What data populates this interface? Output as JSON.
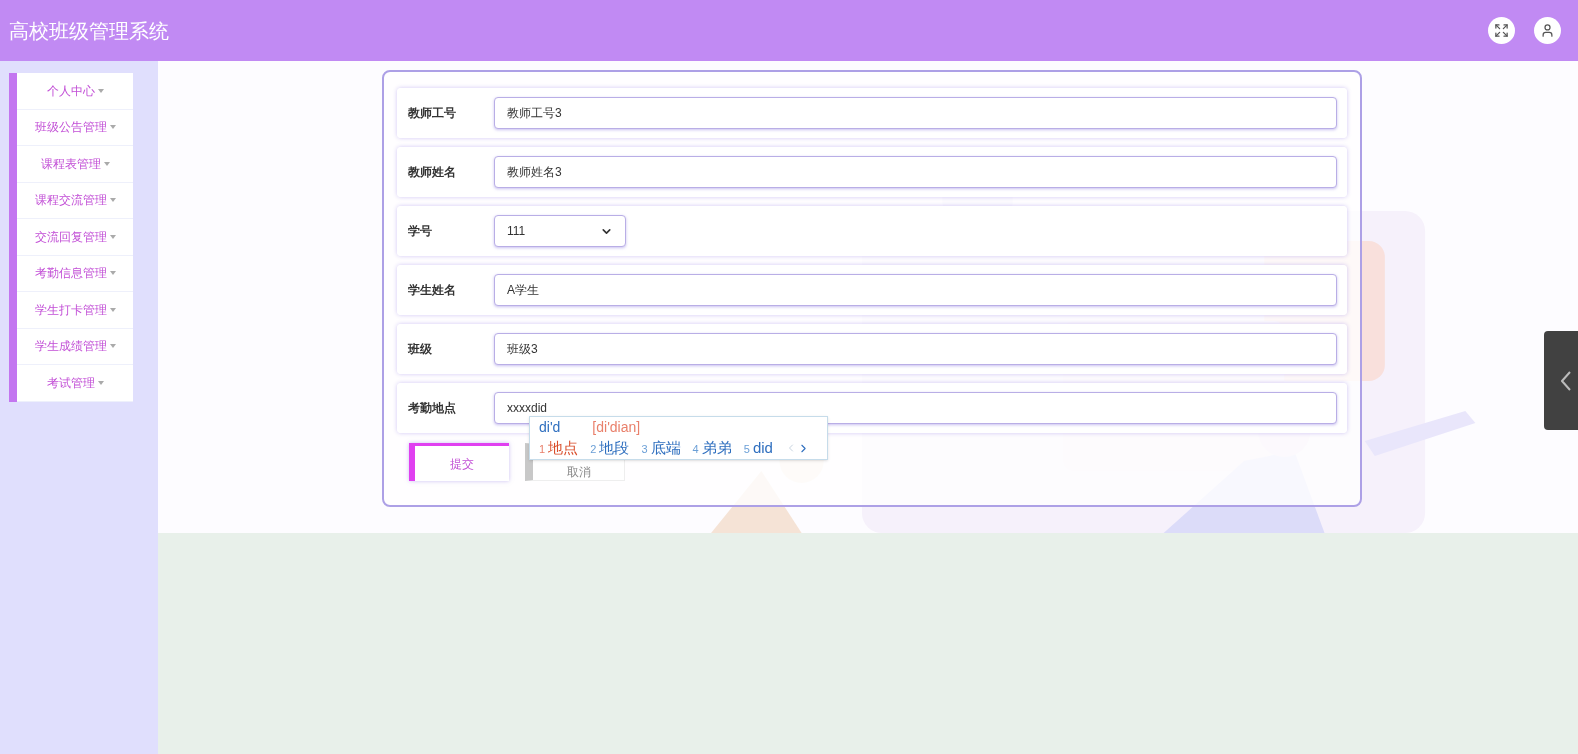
{
  "header": {
    "title": "高校班级管理系统"
  },
  "sidebar": {
    "items": [
      {
        "label": "个人中心"
      },
      {
        "label": "班级公告管理"
      },
      {
        "label": "课程表管理"
      },
      {
        "label": "课程交流管理"
      },
      {
        "label": "交流回复管理"
      },
      {
        "label": "考勤信息管理"
      },
      {
        "label": "学生打卡管理"
      },
      {
        "label": "学生成绩管理"
      },
      {
        "label": "考试管理"
      }
    ]
  },
  "form": {
    "fields": [
      {
        "kind": "text",
        "label": "教师工号",
        "value": "教师工号3"
      },
      {
        "kind": "text",
        "label": "教师姓名",
        "value": "教师姓名3"
      },
      {
        "kind": "select",
        "label": "学号",
        "value": "111"
      },
      {
        "kind": "text",
        "label": "学生姓名",
        "value": "A学生"
      },
      {
        "kind": "text",
        "label": "班级",
        "value": "班级3"
      },
      {
        "kind": "text",
        "label": "考勤地点",
        "value": "xxxxdid"
      }
    ],
    "buttons": [
      {
        "kind": "submit",
        "label": "提交"
      },
      {
        "kind": "cancel",
        "label": "取消"
      }
    ]
  },
  "ime": {
    "composition": "di'd",
    "hint": "[di'dian]",
    "candidates": [
      {
        "index": "1",
        "text": "地点",
        "selected": true
      },
      {
        "index": "2",
        "text": "地段",
        "selected": false
      },
      {
        "index": "3",
        "text": "底端",
        "selected": false
      },
      {
        "index": "4",
        "text": "弟弟",
        "selected": false
      },
      {
        "index": "5",
        "text": "did",
        "selected": false
      }
    ]
  }
}
